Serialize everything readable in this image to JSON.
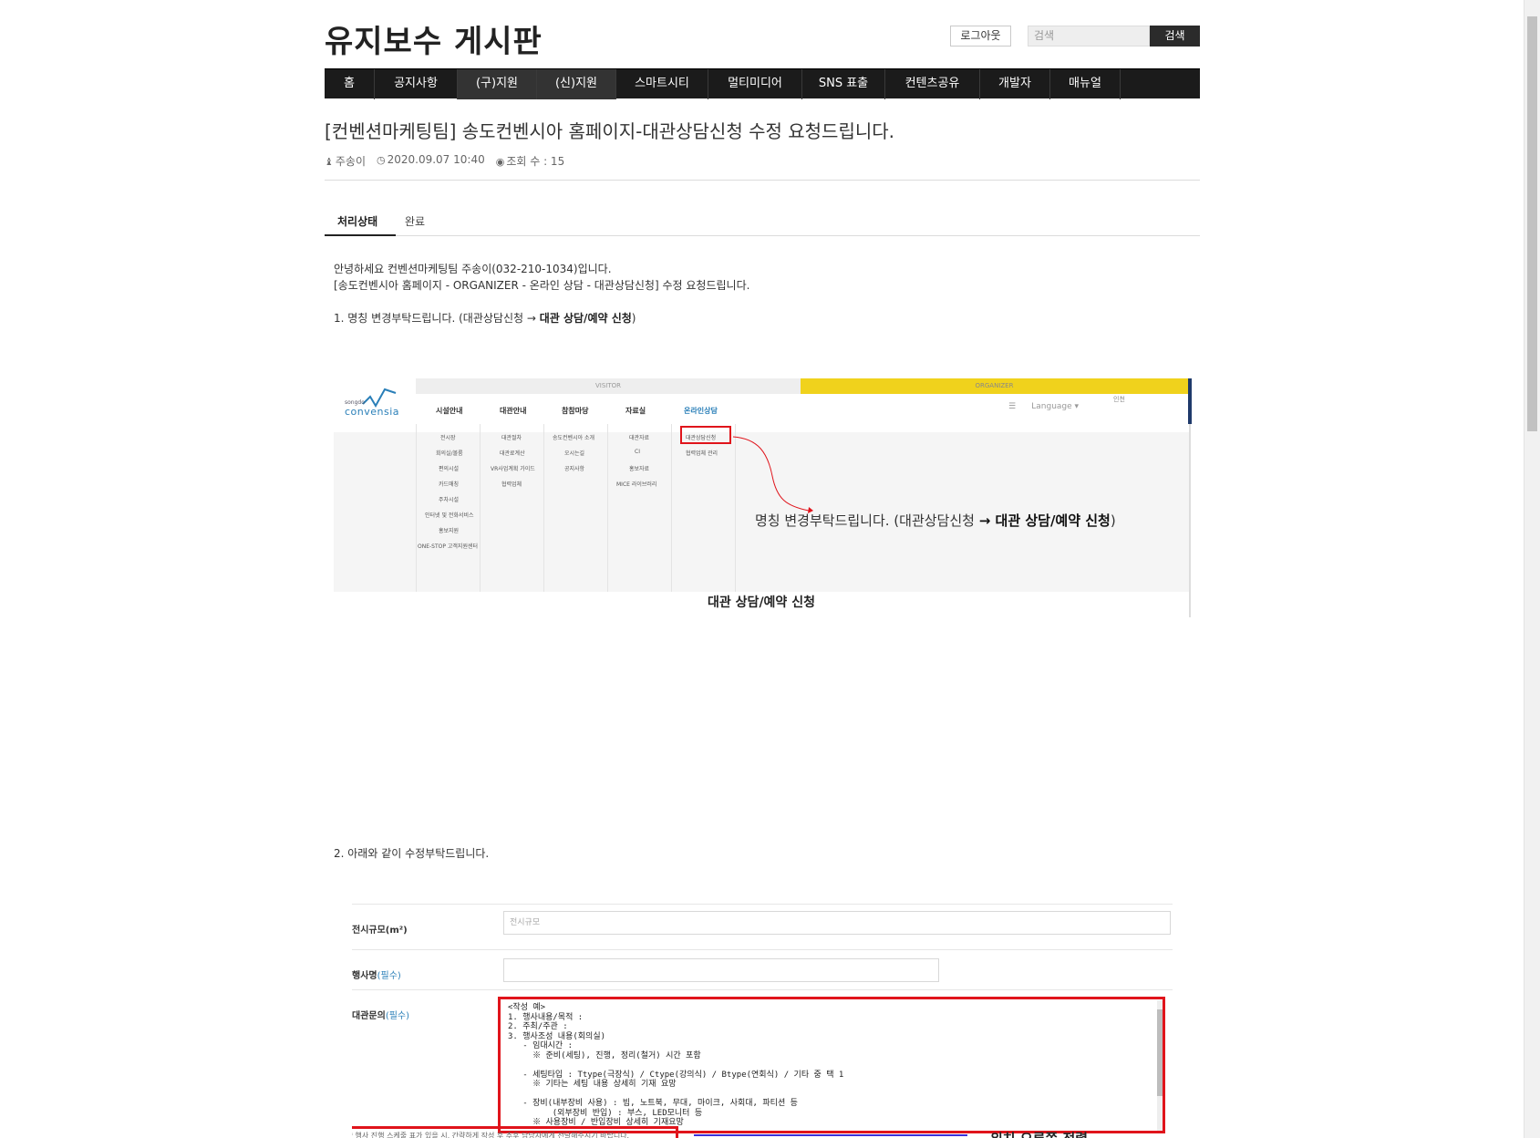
{
  "header": {
    "site_title": "유지보수 게시판",
    "logout_label": "로그아웃",
    "search_placeholder": "검색",
    "search_label": "검색"
  },
  "nav": {
    "items": [
      {
        "label": "홈",
        "active": false
      },
      {
        "label": "공지사항",
        "active": false
      },
      {
        "label": "(구)지원",
        "active": true
      },
      {
        "label": "(신)지원",
        "active": true
      },
      {
        "label": "스마트시티",
        "active": false
      },
      {
        "label": "멀티미디어",
        "active": false
      },
      {
        "label": "SNS 표출",
        "active": false
      },
      {
        "label": "컨텐츠공유",
        "active": false
      },
      {
        "label": "개발자",
        "active": false
      },
      {
        "label": "매뉴얼",
        "active": false
      }
    ]
  },
  "post": {
    "title": "[컨벤션마케팅팀] 송도컨벤시아 홈페이지-대관상담신청 수정 요청드립니다.",
    "author": "주송이",
    "datetime": "2020.09.07 10:40",
    "views": "조회 수 : 15",
    "status_label": "처리상태",
    "status_value": "완료",
    "line1": "안녕하세요 컨벤션마케팅팀 주송이(032-210-1034)입니다.",
    "line2": "[송도컨벤시아 홈페이지 - ORGANIZER - 온라인 상담 - 대관상담신청] 수정 요청드립니다.",
    "item1_prefix": "1. 명칭 변경부탁드립니다. (대관상담신청 → ",
    "item1_bold": "대관 상담/예약 신청",
    "item1_suffix": ")",
    "item2": "2. 아래와 같이 수정부탁드립니다."
  },
  "shot1": {
    "visitor": "VISITOR",
    "organizer": "ORGANIZER",
    "logo_top": "songdo",
    "logo": "convensia",
    "language": "Language ▾",
    "incheon": "인천",
    "menus": [
      "시설안내",
      "대관안내",
      "참참마당",
      "자료실",
      "온라인상담"
    ],
    "subs": [
      [
        "전시장",
        "회의실/볼룸",
        "편의시설",
        "카드매칭",
        "주차시설",
        "인터넷 및 전화서비스",
        "홍보지원",
        "ONE-STOP 고객지원센터"
      ],
      [
        "대관절차",
        "대관료계산",
        "VR사업계획 가이드",
        "협력업체"
      ],
      [
        "송도컨벤시아 소개",
        "오시는길",
        "공지사항"
      ],
      [
        "대관자료",
        "CI",
        "홍보자료",
        "MICE 라이브러리"
      ],
      [
        "대관상담신청",
        "협력업체 관리"
      ]
    ],
    "note_prefix": "명칭 변경부탁드립니다. (대관상담신청 ",
    "note_bold": "→ 대관 상담/예약 신청",
    "note_suffix": ")",
    "caption": "대관 상담/예약 신청"
  },
  "shot2": {
    "field1_label": "전시규모(m²)",
    "field1_placeholder": "전시규모",
    "field2_label": "행사명",
    "field2_req": "(필수)",
    "field3_label": "대관문의",
    "field3_req": "(필수)",
    "textarea": "<작성 예>\n1. 행사내용/목적 :\n2. 주최/주관 :\n3. 행사조성 내용(회의실)\n   - 임대시간 :\n     ※ 준비(세팅), 진행, 정리(철거) 시간 포함\n\n   - 세팅타입 : Ttype(극장식) / Ctype(강의식) / Btype(연회식) / 기타 중 택 1\n     ※ 기타는 세팅 내용 상세히 기재 요망\n\n   - 장비(내부장비 사용) : 빔, 노트북, 무대, 마이크, 사회대, 파티션 등\n         (외부장비 반입) : 부스, LED모니터 등\n     ※ 사용장비 / 반입장비 상세히 기재요망",
    "notice": "* 행사 진행 스케줄 표가 있을 시, 간략하게 작성 후 추후 담당자에게 전달해주시기 바랍니다.",
    "arrow_note": "위치 오른쪽 정렬"
  }
}
